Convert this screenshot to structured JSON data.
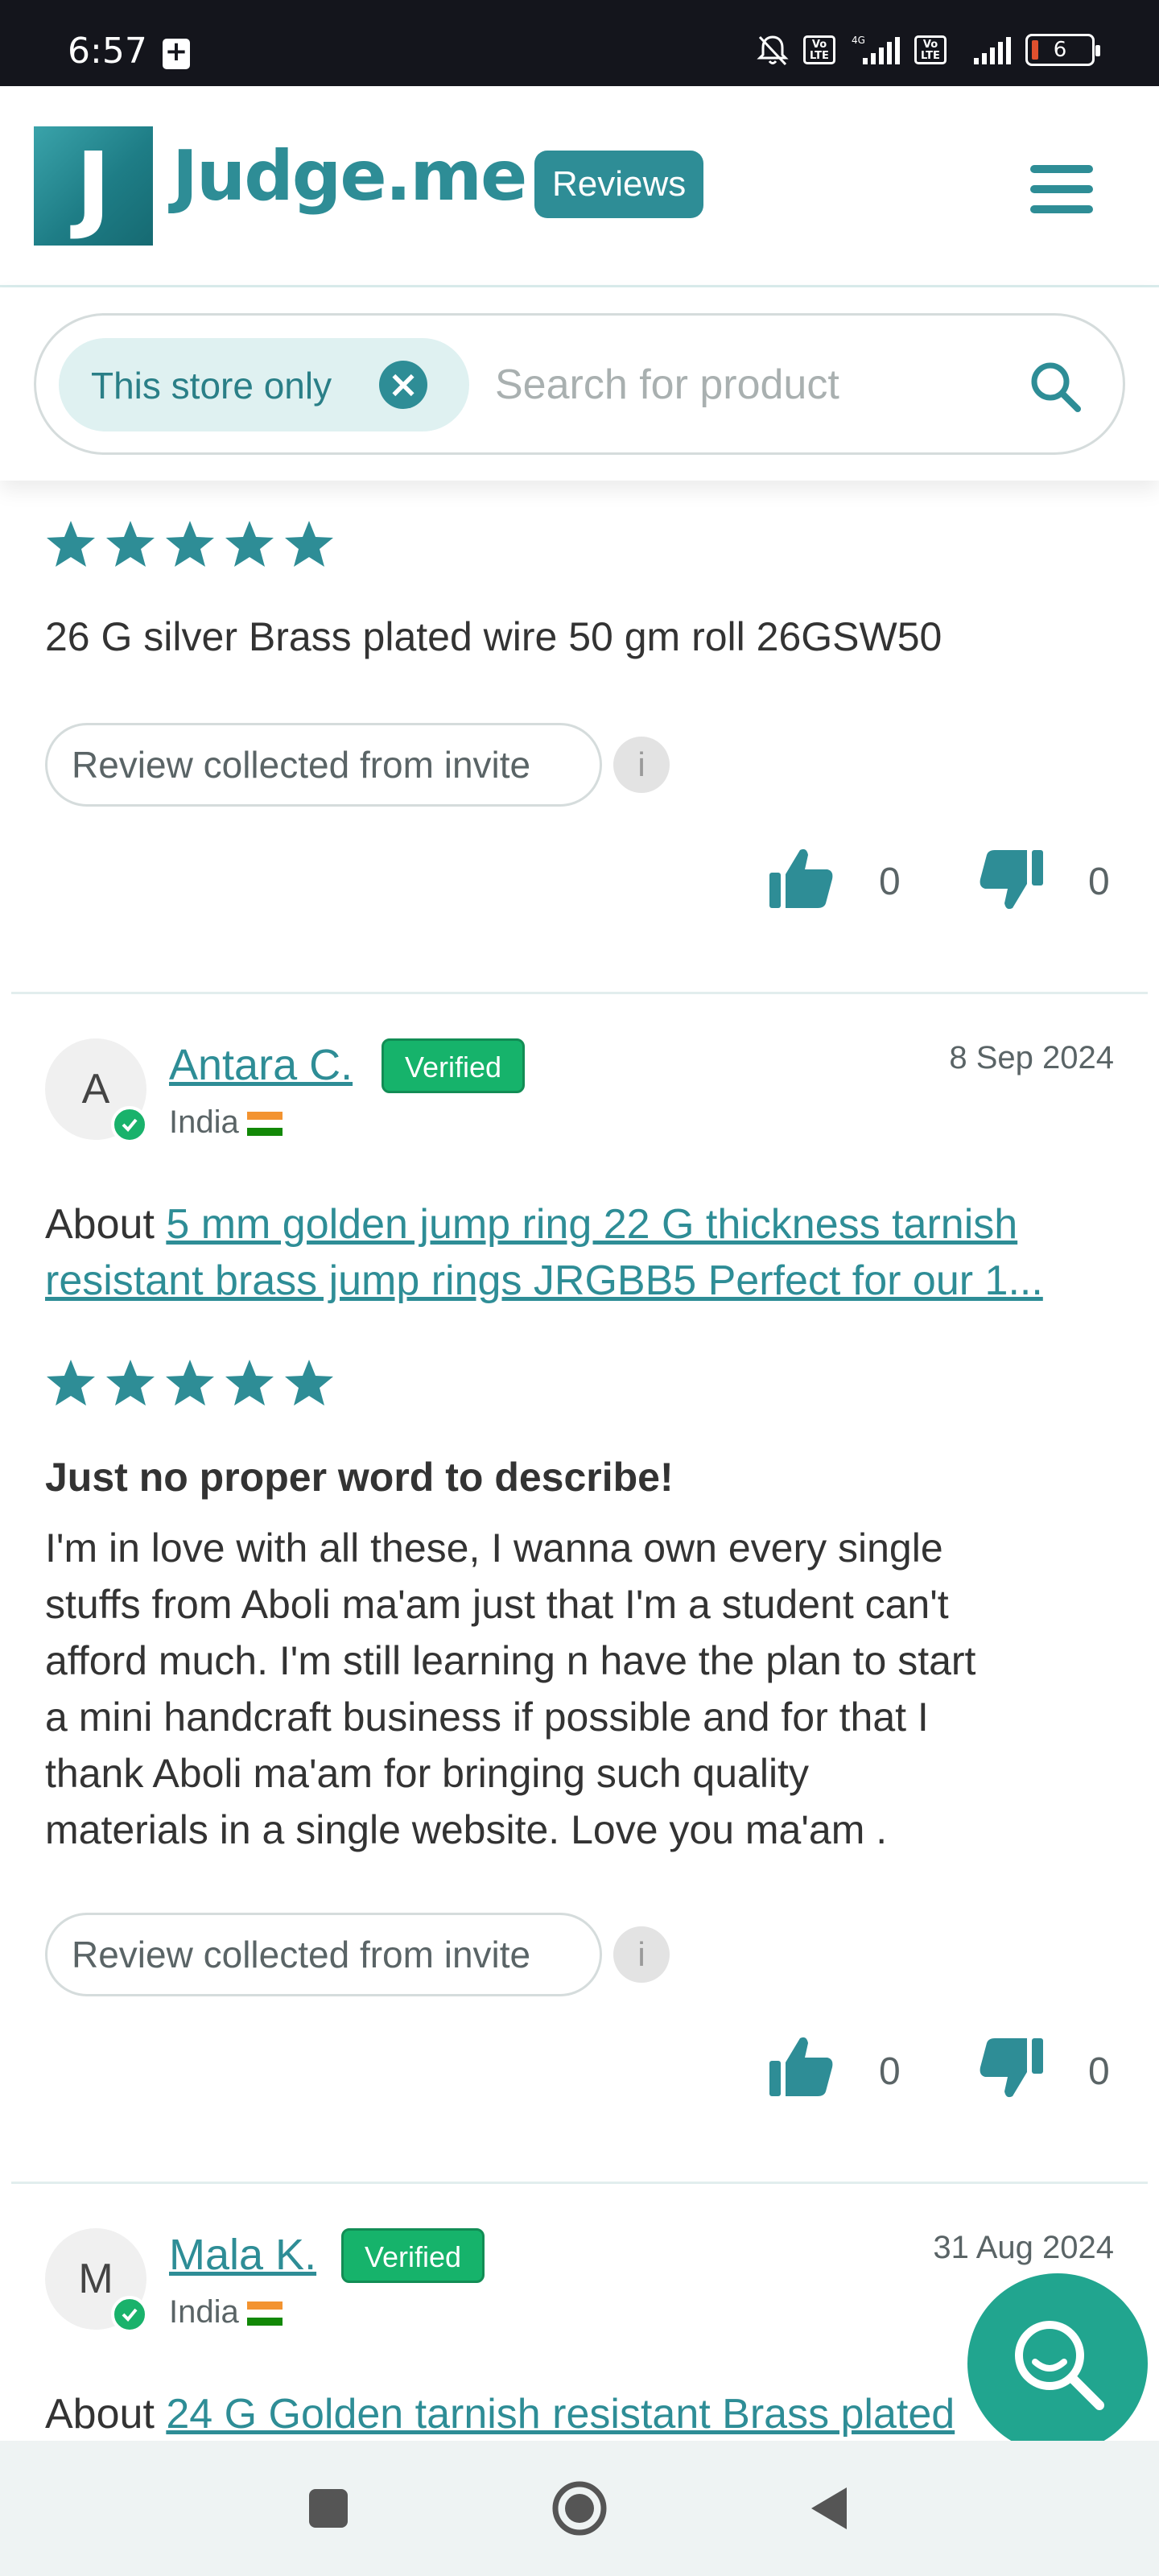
{
  "status_bar": {
    "time": "6:57",
    "network": "4G",
    "volte_label": "Vo LTE",
    "battery": "6"
  },
  "header": {
    "logo_letter": "J",
    "brand": "Judge.me",
    "badge": "Reviews"
  },
  "search": {
    "filter_chip": "This store only",
    "placeholder": "Search for product"
  },
  "reviews": [
    {
      "stars": 5,
      "body": "26 G silver Brass plated wire 50 gm roll 26GSW50",
      "source": "Review collected from invite",
      "info": "i",
      "likes": "0",
      "dislikes": "0"
    },
    {
      "avatar": "A",
      "name": "Antara C.",
      "badge": "Verified",
      "country": "India",
      "date": "8 Sep 2024",
      "about_prefix": "About",
      "product_line1": "5 mm golden jump ring 22 G thickness tarnish",
      "product_line2": "resistant brass jump rings JRGBB5 Perfect for our 1...",
      "stars": 5,
      "title": "Just no proper word to describe!",
      "body_lines": [
        "I'm in love with all these, I wanna own every single",
        "stuffs from Aboli ma'am just that I'm a student can't",
        "afford much. I'm still learning n have the plan to start",
        "a mini handcraft business if possible and for that I",
        "thank Aboli ma'am for bringing such quality",
        "materials in a single website. Love you ma'am ."
      ],
      "source": "Review collected from invite",
      "info": "i",
      "likes": "0",
      "dislikes": "0"
    },
    {
      "avatar": "M",
      "name": "Mala K.",
      "badge": "Verified",
      "country": "India",
      "date": "31 Aug 2024",
      "about_prefix": "About",
      "product_line1": "24 G Golden tarnish resistant Brass plated"
    }
  ],
  "colors": {
    "brand": "#2e8d96",
    "verified": "#16b36b",
    "fab": "#21a58f",
    "status_bar": "#14151c"
  },
  "icons": {
    "search": "search-icon",
    "menu": "hamburger-menu-icon",
    "thumbs_up": "thumbs-up-icon",
    "thumbs_down": "thumbs-down-icon"
  }
}
